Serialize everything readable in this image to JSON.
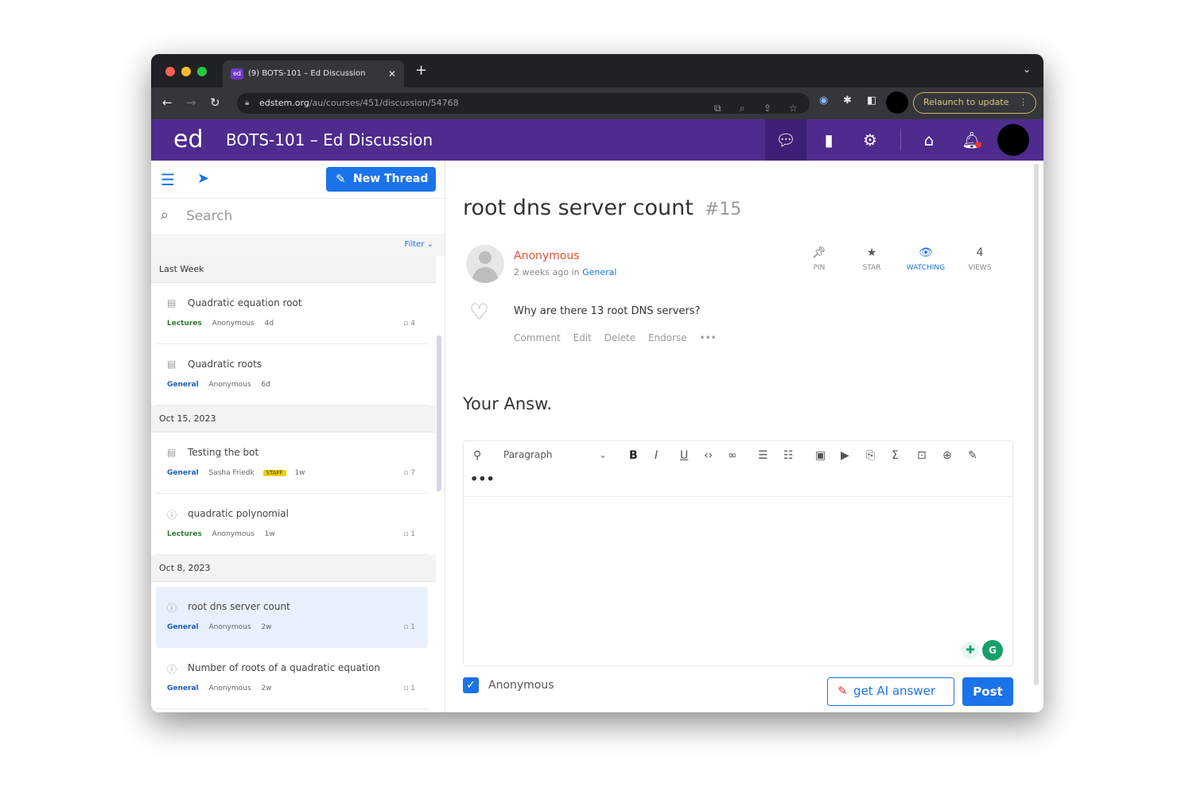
{
  "browser": {
    "tab_title": "(9) BOTS-101 – Ed Discussion",
    "tab_favicon": "ed",
    "url_host": "edstem.org",
    "url_path": "/au/courses/451/discussion/54768",
    "relaunch_label": "Relaunch to update",
    "traffic_colors": [
      "#ff5f57",
      "#febc2e",
      "#28c840"
    ]
  },
  "app": {
    "logo": "ed",
    "title": "BOTS-101 – Ed Discussion",
    "brand_color": "#4f2b8e"
  },
  "sidebar": {
    "new_thread_label": "New Thread",
    "search_placeholder": "Search",
    "filter_label": "Filter ⌄",
    "groups": [
      {
        "label": "Last Week",
        "threads": [
          {
            "title": "Quadratic equation root",
            "category": "Lectures",
            "author": "Anonymous",
            "age": "4d",
            "count": "4"
          },
          {
            "title": "Quadratic roots",
            "category": "General",
            "author": "Anonymous",
            "age": "6d",
            "count": ""
          }
        ]
      },
      {
        "label": "Oct 15, 2023",
        "threads": [
          {
            "title": "Testing the bot",
            "category": "General",
            "author": "Sasha Friedk",
            "badge": "STAFF",
            "age": "1w",
            "count": "7"
          },
          {
            "title": "quadratic polynomial",
            "category": "Lectures",
            "author": "Anonymous",
            "age": "1w",
            "count": "1"
          }
        ]
      },
      {
        "label": "Oct 8, 2023",
        "threads": [
          {
            "title": "root dns server count",
            "category": "General",
            "author": "Anonymous",
            "age": "2w",
            "count": "1"
          },
          {
            "title": "Number of roots of a quadratic equation",
            "category": "General",
            "author": "Anonymous",
            "age": "2w",
            "count": "1"
          }
        ]
      }
    ]
  },
  "thread": {
    "title": "root dns server count",
    "number": "#15",
    "author": "Anonymous",
    "posted": "2 weeks ago in",
    "category": "General",
    "question": "Why are there 13 root DNS servers?",
    "actions": [
      "Comment",
      "Edit",
      "Delete",
      "Endorse",
      "•••"
    ],
    "stats": {
      "pin": "PIN",
      "star": "STAR",
      "watching": "WATCHING",
      "views_count": "4",
      "views": "VIEWS"
    }
  },
  "answer": {
    "heading": "Your Answ.",
    "paragraph_style": "Paragraph",
    "more": "•••",
    "anonymous_label": "Anonymous",
    "anonymous_checked": true,
    "ai_button": "get AI answer",
    "post_button": "Post"
  }
}
